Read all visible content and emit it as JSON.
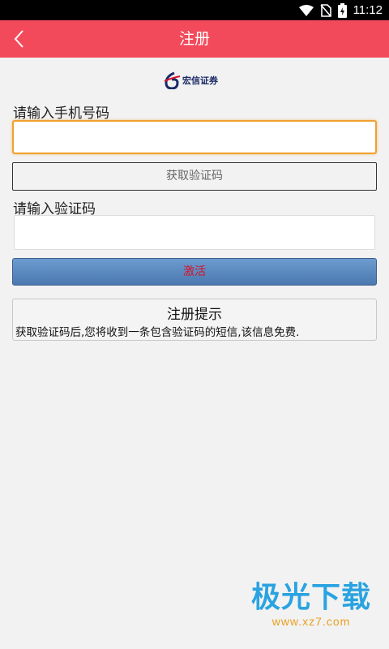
{
  "status_bar": {
    "time": "11:12"
  },
  "app_bar": {
    "title": "注册"
  },
  "logo": {
    "text": "宏信证券"
  },
  "form": {
    "phone_label": "请输入手机号码",
    "phone_value": "",
    "get_code_label": "获取验证码",
    "code_label": "请输入验证码",
    "code_value": "",
    "activate_label": "激活"
  },
  "tips": {
    "title": "注册提示",
    "text": "获取验证码后,您将收到一条包含验证码的短信,该信息免费."
  },
  "watermark": {
    "title": "极光下载",
    "url": "www.xz7.com"
  },
  "colors": {
    "app_bar": "#f24a5b",
    "activate_button": "#5a88c0",
    "activate_text": "#d4142a",
    "focus_border": "#f0a030"
  }
}
